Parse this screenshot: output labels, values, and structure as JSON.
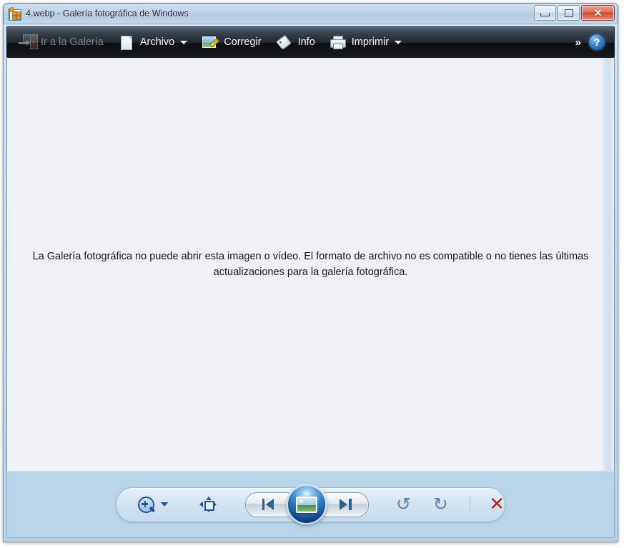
{
  "window": {
    "title": "4.webp - Galería fotográfica de Windows",
    "app_icon": "photo-gallery-icon",
    "controls": {
      "minimize_label": "—",
      "maximize_label": "□",
      "close_label": "✕"
    }
  },
  "toolbar": {
    "items": [
      {
        "label": "Ir a la Galería",
        "icon": "gallery-grid-icon",
        "disabled": true,
        "has_caret": false
      },
      {
        "label": "Archivo",
        "icon": "document-icon",
        "disabled": false,
        "has_caret": true
      },
      {
        "label": "Corregir",
        "icon": "photo-edit-icon",
        "disabled": false,
        "has_caret": false
      },
      {
        "label": "Info",
        "icon": "tag-icon",
        "disabled": false,
        "has_caret": false
      },
      {
        "label": "Imprimir",
        "icon": "printer-icon",
        "disabled": false,
        "has_caret": true
      }
    ],
    "overflow_label": "»",
    "help_label": "?"
  },
  "content": {
    "message": "La Galería fotográfica no puede abrir esta imagen o vídeo. El formato de archivo no es compatible o no tienes las últimas actualizaciones para la galería fotográfica."
  },
  "bottom_bar": {
    "zoom": {
      "icon": "zoom-in-magnifier-icon",
      "caret": "▾"
    },
    "fit_to_window": {
      "icon": "fit-to-window-icon"
    },
    "previous": {
      "icon": "previous-image-icon"
    },
    "slideshow": {
      "icon": "slideshow-photo-icon"
    },
    "next": {
      "icon": "next-image-icon"
    },
    "rotate_ccw": {
      "icon": "rotate-counterclockwise-icon",
      "glyph": "↺"
    },
    "rotate_cw": {
      "icon": "rotate-clockwise-icon",
      "glyph": "↻"
    },
    "delete": {
      "icon": "delete-x-icon",
      "glyph": "✕"
    }
  },
  "colors": {
    "frame": "#b6cfe6",
    "toolbar_dark": "#20262d",
    "content_bg": "#f0f1f6",
    "bottom_bar": "#b9d5ea",
    "accent_blue": "#1d52a0",
    "delete_red": "#b12222",
    "close_red": "#cc4a30"
  }
}
